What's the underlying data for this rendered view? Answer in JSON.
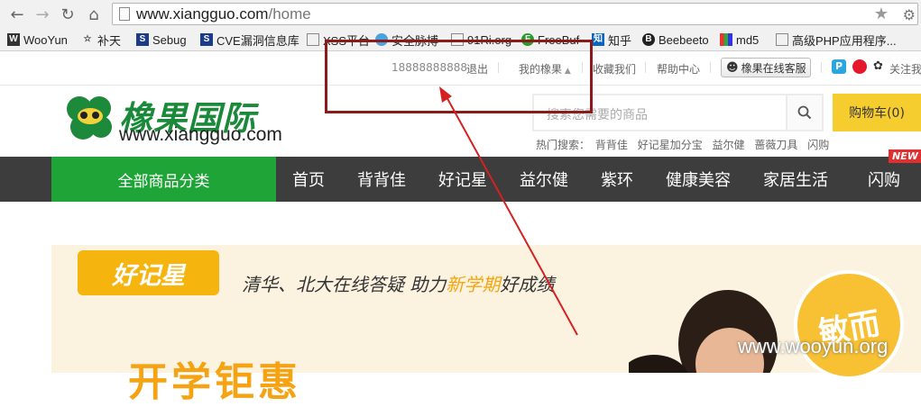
{
  "browser": {
    "url_host": "www.xiangguo.com",
    "url_path": "/home",
    "bookmarks": [
      "WooYun",
      "补天",
      "Sebug",
      "CVE漏洞信息库",
      "XSS平台",
      "安全脉搏",
      "91Ri.org",
      "FreeBuf",
      "知乎",
      "Beebeeto",
      "md5",
      "高级PHP应用程序..."
    ]
  },
  "topbar": {
    "phone": "18888888888",
    "logout": "退出",
    "my_account": "我的橡果",
    "favorite": "收藏我们",
    "help": "帮助中心",
    "online_service": "橡果在线客服",
    "follow": "关注我"
  },
  "header": {
    "logo_name": "橡果国际",
    "logo_url": "www.xiangguo.com",
    "search_placeholder": "搜索您需要的商品",
    "cart_label": "购物车(0)",
    "hot_label": "热门搜索：",
    "hot_terms": [
      "背背佳",
      "好记星加分宝",
      "益尔健",
      "蔷薇刀具",
      "闪购"
    ]
  },
  "nav": {
    "category": "全部商品分类",
    "items": [
      "首页",
      "背背佳",
      "好记星",
      "益尔健",
      "紫环",
      "健康美容",
      "家居生活",
      "闪购"
    ],
    "new_badge": "NEW"
  },
  "banner": {
    "brand": "好记星",
    "slogan_prefix": "清华、北大在线答疑 助力",
    "slogan_highlight": "新学期",
    "slogan_suffix": "好成绩",
    "big_title": "开学钜惠",
    "stamp": "敏而"
  },
  "watermark": "www.wooyun.org",
  "colors": {
    "nav_bg": "#3d3d3d",
    "category_bg": "#1fa437",
    "cart_bg": "#f6cd2e",
    "brand_green": "#1a8a3a",
    "annotation": "#cc1f1f"
  }
}
